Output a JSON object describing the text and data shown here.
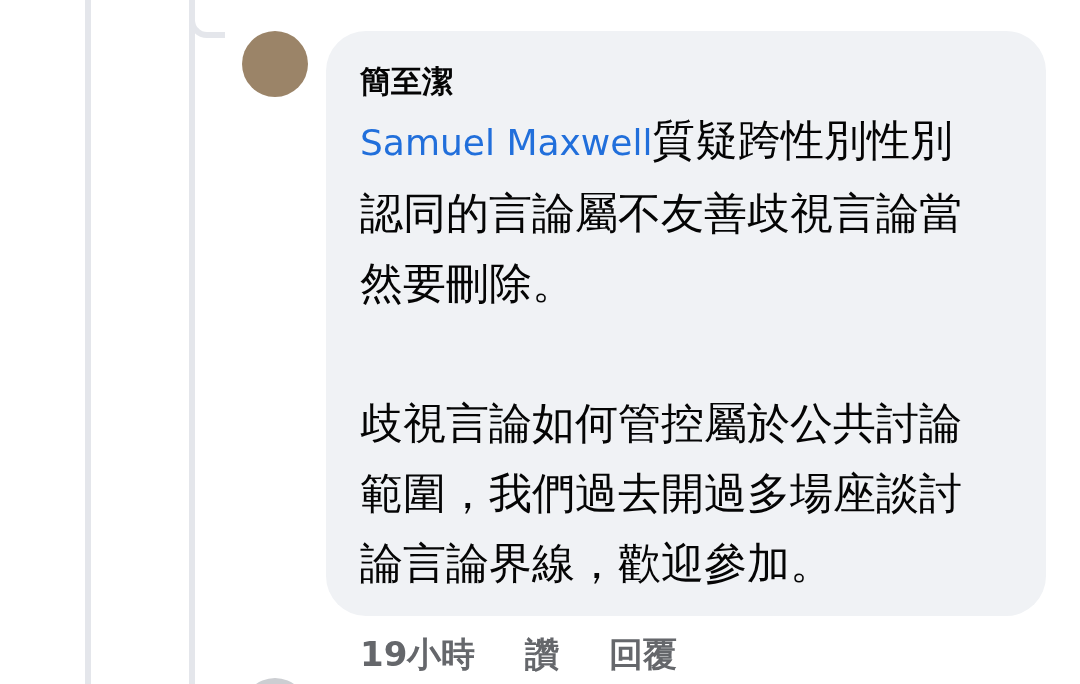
{
  "comment": {
    "author": "簡至潔",
    "mention": "Samuel Maxwell",
    "paragraphs": [
      "質疑跨性別性別認同的言論屬不友善歧視言論當然要刪除。",
      "歧視言論如何管控屬於公共討論範圍，我們過去開過多場座談討論言論界線，歡迎參加。"
    ],
    "time": "19小時",
    "actions": [
      "讚",
      "回覆"
    ]
  }
}
